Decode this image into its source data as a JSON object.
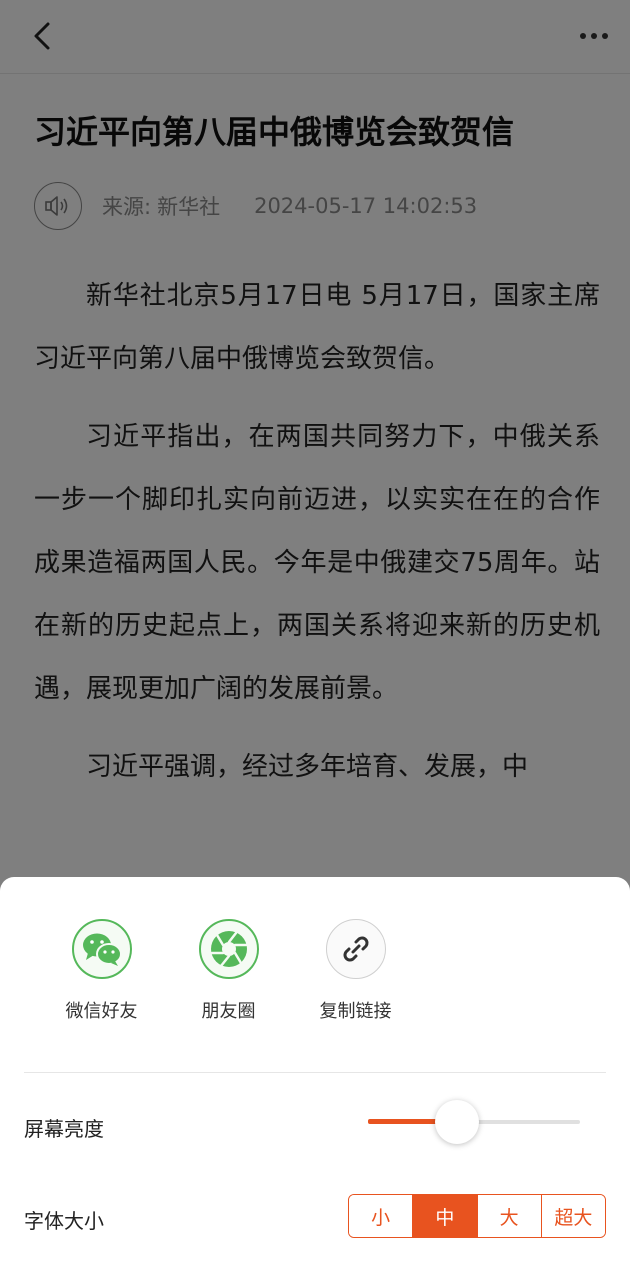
{
  "article": {
    "title": "习近平向第八届中俄博览会致贺信",
    "source_label": "来源:",
    "source": "新华社",
    "datetime": "2024-05-17 14:02:53",
    "paragraphs": [
      "新华社北京5月17日电 5月17日，国家主席习近平向第八届中俄博览会致贺信。",
      "习近平指出，在两国共同努力下，中俄关系一步一个脚印扎实向前迈进，以实实在在的合作成果造福两国人民。今年是中俄建交75周年。站在新的历史起点上，两国关系将迎来新的历史机遇，展现更加广阔的发展前景。",
      "习近平强调，经过多年培育、发展，中"
    ]
  },
  "share": {
    "items": [
      {
        "label": "微信好友",
        "icon": "wechat-icon"
      },
      {
        "label": "朋友圈",
        "icon": "moments-icon"
      },
      {
        "label": "复制链接",
        "icon": "link-icon"
      }
    ]
  },
  "settings": {
    "brightness_label": "屏幕亮度",
    "brightness_value": 0.42,
    "font_size_label": "字体大小",
    "font_sizes": [
      "小",
      "中",
      "大",
      "超大"
    ],
    "font_size_selected": "中"
  },
  "colors": {
    "accent": "#e8531f",
    "wechat_green": "#55b85a"
  }
}
